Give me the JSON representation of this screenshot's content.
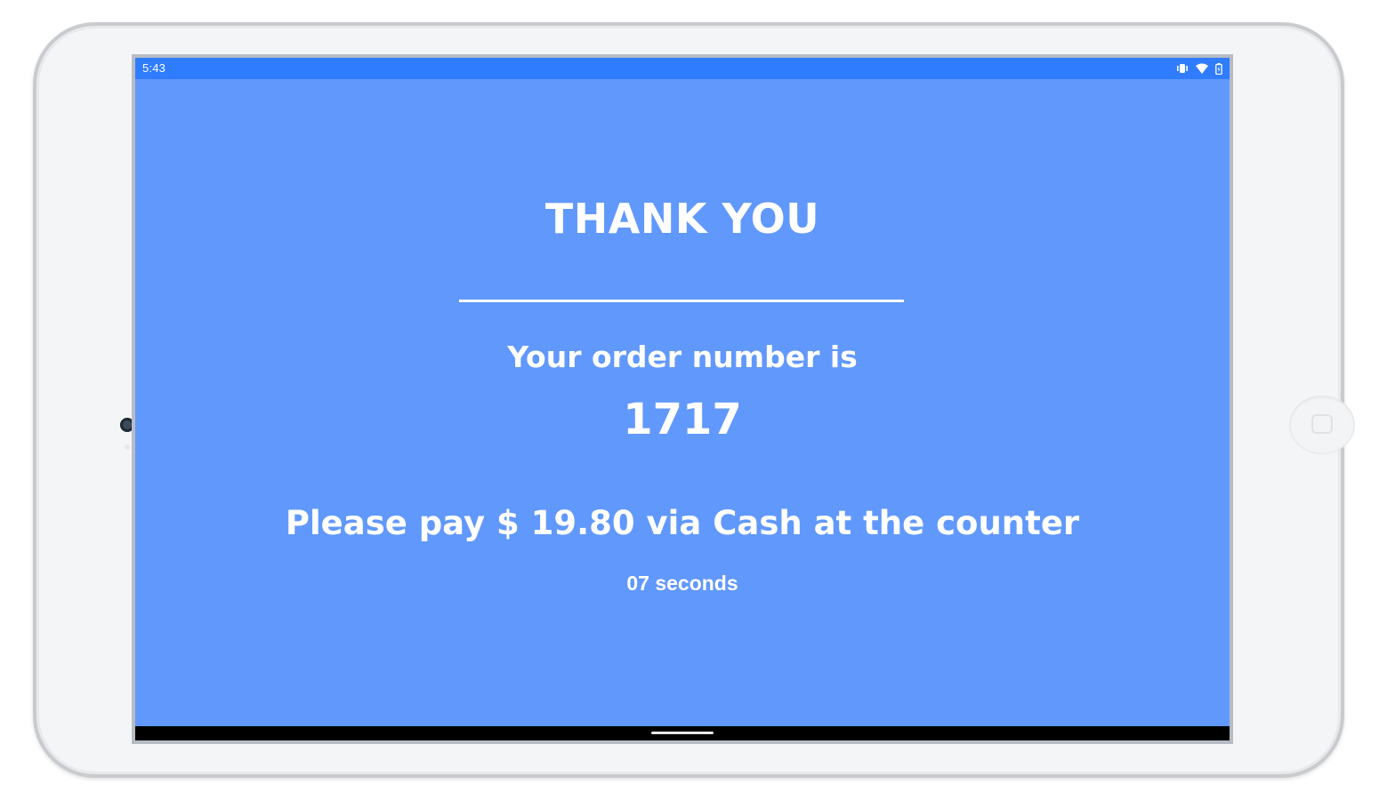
{
  "status_bar": {
    "time": "5:43",
    "icons": [
      "vibrate-icon",
      "wifi-icon",
      "battery-icon"
    ]
  },
  "confirmation": {
    "title": "THANK YOU",
    "order_label": "Your order number is",
    "order_number": "1717",
    "payment_message": "Please pay $ 19.80 via Cash at the counter",
    "countdown": "07 seconds"
  },
  "colors": {
    "screen_background": "#6198fc",
    "status_bar": "#2f7cff",
    "text": "#ffffff",
    "nav_bar": "#000000"
  }
}
